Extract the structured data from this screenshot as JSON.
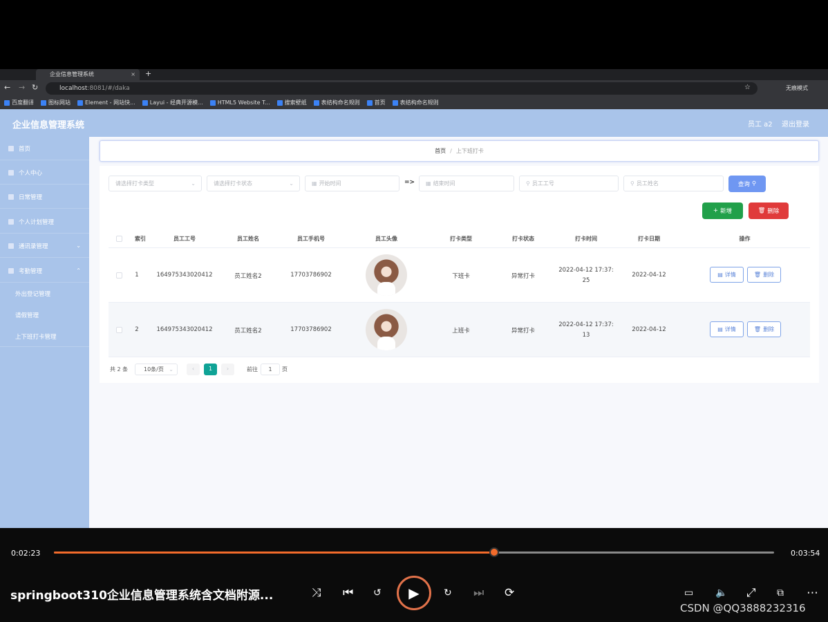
{
  "browser": {
    "tab_title": "企业信息管理系统",
    "tab_close": "×",
    "new_tab": "+",
    "url_host": "localhost",
    "url_path": ":8081/#/daka",
    "incognito_label": "无痕模式",
    "bookmarks": [
      "百度翻译",
      "图标网站",
      "Element - 网站快...",
      "Layui - 经典开源模...",
      "HTML5 Website T...",
      "搜索壁纸",
      "表结构命名规则",
      "首页",
      "表结构命名规则"
    ]
  },
  "app": {
    "title": "企业信息管理系统",
    "user_label": "员工 a2",
    "logout_label": "退出登录"
  },
  "sidebar": {
    "items": [
      {
        "label": "首页",
        "icon": "home-icon"
      },
      {
        "label": "个人中心",
        "icon": "user-icon"
      },
      {
        "label": "日常管理",
        "icon": "doc-icon"
      },
      {
        "label": "个人计划管理",
        "icon": "briefcase-icon"
      },
      {
        "label": "通讯录管理",
        "icon": "contacts-icon"
      },
      {
        "label": "考勤管理",
        "icon": "grid-icon"
      }
    ],
    "sub_items": [
      "外出登记管理",
      "请假管理",
      "上下班打卡管理"
    ]
  },
  "breadcrumb": {
    "home": "首页",
    "separator": "/",
    "current": "上下班打卡"
  },
  "filters": {
    "clock_type_placeholder": "请选择打卡类型",
    "clock_status_placeholder": "请选择打卡状态",
    "start_time_placeholder": "开始时间",
    "range_separator": "=>",
    "end_time_placeholder": "结束时间",
    "employee_no_placeholder": "员工工号",
    "employee_name_placeholder": "员工姓名",
    "search_label": "查询"
  },
  "actions": {
    "add_label": "新增",
    "delete_label": "删除"
  },
  "table": {
    "headers": [
      "索引",
      "员工工号",
      "员工姓名",
      "员工手机号",
      "员工头像",
      "打卡类型",
      "打卡状态",
      "打卡时间",
      "打卡日期",
      "操作"
    ],
    "rows": [
      {
        "index": "1",
        "emp_no": "164975343020412",
        "name": "员工姓名2",
        "phone": "17703786902",
        "type": "下班卡",
        "status": "异常打卡",
        "time_line1": "2022-04-12 17:37:",
        "time_line2": "25",
        "date": "2022-04-12"
      },
      {
        "index": "2",
        "emp_no": "164975343020412",
        "name": "员工姓名2",
        "phone": "17703786902",
        "type": "上班卡",
        "status": "异常打卡",
        "time_line1": "2022-04-12 17:37:",
        "time_line2": "13",
        "date": "2022-04-12"
      }
    ],
    "detail_label": "详情",
    "row_delete_label": "删除"
  },
  "pagination": {
    "total": "共 2 条",
    "page_size": "10条/页",
    "current_page": "1",
    "goto_label": "前往",
    "goto_value": "1",
    "page_suffix": "页"
  },
  "player": {
    "elapsed": "0:02:23",
    "duration": "0:03:54",
    "progress": 0.611,
    "title": "springboot310企业信息管理系统含文档附源...",
    "watermark": "CSDN @QQ3888232316",
    "accent": "#f36b2b"
  }
}
